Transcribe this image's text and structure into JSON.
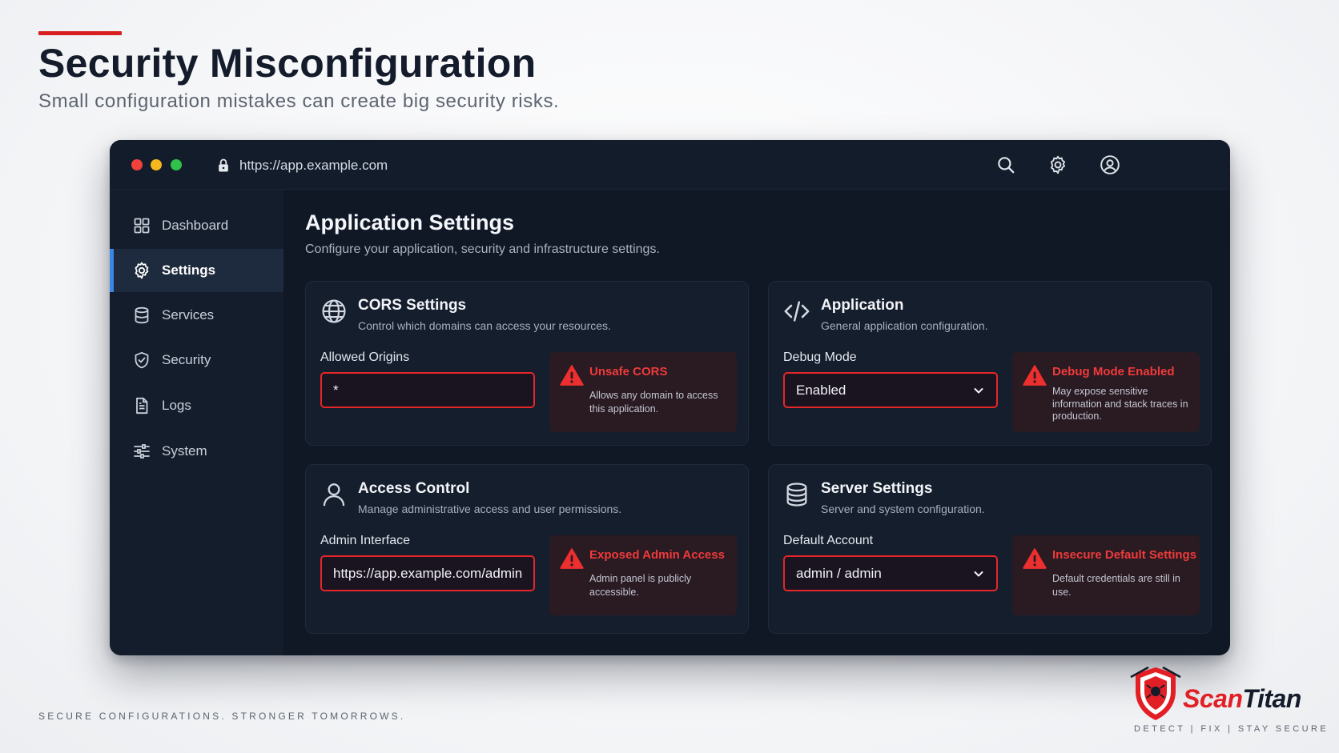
{
  "slide": {
    "title": "Security Misconfiguration",
    "subtitle": "Small configuration mistakes can create big security risks.",
    "footer_tagline": "SECURE CONFIGURATIONS.  STRONGER TOMORROWS.",
    "accent_color": "#d81e1e"
  },
  "browser": {
    "url": "https://app.example.com",
    "traffic_lights": [
      "#f0413a",
      "#f5b81f",
      "#2fc14a"
    ],
    "toolbar_icons": [
      "search-icon",
      "gear-icon",
      "user-circle-icon"
    ]
  },
  "sidebar": {
    "active_color": "#3a86e8",
    "items": [
      {
        "label": "Dashboard",
        "icon": "grid-icon",
        "active": false
      },
      {
        "label": "Settings",
        "icon": "gear-icon",
        "active": true
      },
      {
        "label": "Services",
        "icon": "database-icon",
        "active": false
      },
      {
        "label": "Security",
        "icon": "shield-check-icon",
        "active": false
      },
      {
        "label": "Logs",
        "icon": "document-icon",
        "active": false
      },
      {
        "label": "System",
        "icon": "sliders-icon",
        "active": false
      }
    ]
  },
  "main": {
    "title": "Application Settings",
    "subtitle": "Configure your application, security and infrastructure settings.",
    "cards": [
      {
        "title": "CORS Settings",
        "description": "Control which domains can access your resources.",
        "icon": "globe-icon",
        "field_label": "Allowed Origins",
        "field_value": "*",
        "warning_title": "Unsafe CORS",
        "warning_text": "Allows any domain to access this application."
      },
      {
        "title": "Application",
        "description": "General application configuration.",
        "icon": "code-icon",
        "field_label": "Debug Mode",
        "field_value": "Enabled",
        "warning_title": "Debug Mode Enabled",
        "warning_text": "May expose sensitive information and stack traces in production."
      },
      {
        "title": "Access Control",
        "description": "Manage administrative access and user permissions.",
        "icon": "user-icon",
        "field_label": "Admin Interface",
        "field_value": "https://app.example.com/admin",
        "warning_title": "Exposed Admin Access",
        "warning_text": "Admin panel is publicly accessible."
      },
      {
        "title": "Server Settings",
        "description": "Server and system configuration.",
        "icon": "server-icon",
        "field_label": "Default Account",
        "field_value": "admin / admin",
        "warning_title": "Insecure Default Settings",
        "warning_text": "Default credentials are still in use."
      }
    ],
    "warning_color": "#ef3b3b"
  },
  "brand": {
    "name_part1": "Scan",
    "name_part2": "Titan",
    "tagline": "DETECT  |  FIX  |  STAY SECURE"
  }
}
